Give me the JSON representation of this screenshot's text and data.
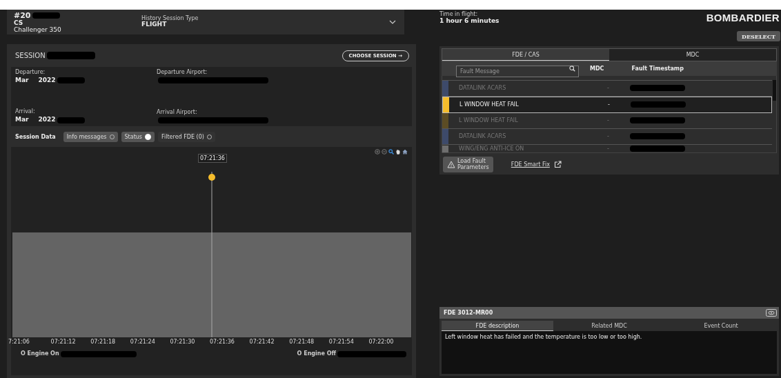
{
  "aircraft": {
    "number": "#20",
    "prefix": "CS",
    "model": "Challenger 350",
    "session_type_label": "History Session Type",
    "session_type": "FLIGHT"
  },
  "session": {
    "title": "SESSION",
    "button": "CHOOSE SESSION →",
    "fields": [
      {
        "label": "Departure:",
        "value_parts": [
          "Mar",
          "2022"
        ]
      },
      {
        "label": "Departure Airport:"
      },
      {
        "label": "Arrival:",
        "value_parts": [
          "Mar",
          "2022"
        ]
      },
      {
        "label": "Arrival Airport:"
      }
    ],
    "data_label": "Session Data",
    "filters": [
      {
        "label": "Info messages",
        "on": false,
        "kind": "chip"
      },
      {
        "label": "Status",
        "on": true,
        "kind": "chip"
      },
      {
        "label": "Filtered FDE (0)",
        "on": false,
        "kind": "plain"
      }
    ]
  },
  "timeline": {
    "tooltip": "07:21:36",
    "ticks": [
      "7:21:06",
      "07:21:12",
      "07:21:18",
      "07:21:24",
      "07:21:30",
      "07:21:36",
      "07:21:42",
      "07:21:48",
      "07:21:54",
      "07:22:00"
    ],
    "engine_on": "O Engine On",
    "engine_off": "O Engine Off"
  },
  "flight": {
    "time_label": "Time in flight:",
    "time": "1 hour 6 minutes",
    "brand": "BOMBARDIER",
    "deselect": "DESELECT"
  },
  "faults": {
    "tabs": [
      {
        "label": "FDE / CAS",
        "selected": true
      },
      {
        "label": "MDC",
        "selected": false
      }
    ],
    "search_placeholder": "Fault Message",
    "columns": [
      "MDC",
      "Fault Timestamp"
    ],
    "rows": [
      {
        "message": "DATALINK ACARS",
        "mdc": "-",
        "color": "#3d4a6a",
        "selected": false
      },
      {
        "message": "L WINDOW HEAT FAIL",
        "mdc": "-",
        "color": "#f5bd2c",
        "selected": true
      },
      {
        "message": "L WINDOW HEAT FAIL",
        "mdc": "-",
        "color": "#5c4c24",
        "selected": false
      },
      {
        "message": "DATALINK ACARS",
        "mdc": "-",
        "color": "#3d4a6a",
        "selected": false
      },
      {
        "message": "WING/ENG ANTI-ICE ON",
        "mdc": "-",
        "color": "#6e6e6e",
        "selected": false
      }
    ],
    "load_button": [
      "Load Fault",
      "Parameters"
    ],
    "smart_fix": "FDE Smart Fix"
  },
  "detail": {
    "title": "FDE 3012-MR00",
    "tabs": [
      {
        "label": "FDE description",
        "selected": true
      },
      {
        "label": "Related MDC",
        "selected": false
      },
      {
        "label": "Event Count",
        "selected": false
      }
    ],
    "description": "Left window heat has failed and the temperature is too low or too high."
  }
}
